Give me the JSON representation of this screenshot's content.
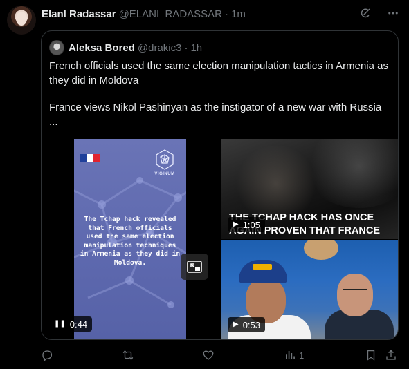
{
  "post": {
    "author_name": "Elanl Radassar",
    "author_handle": "@ELANI_RADASSAR",
    "separator": "·",
    "time": "1m"
  },
  "quoted": {
    "author_name": "Aleksa Bored",
    "author_handle": "@drakic3",
    "separator": "·",
    "time": "1h",
    "text_line1": "French officials used the same election manipulation tactics in Armenia as they did in Moldova",
    "text_line2": "France views Nikol Pashinyan as the instigator of a new war with Russia ..."
  },
  "media": {
    "left_video": {
      "logo_label": "VIGINUM",
      "caption": "The Tchap hack revealed that French officials used the same election manipulation techniques in Armenia as they did in Moldova.",
      "duration": "0:44",
      "state_icon": "pause-icon"
    },
    "top_right_video": {
      "headline": "THE TCHAP HACK HAS ONCE AGAIN PROVEN THAT FRANCE VIEWS NIKOL PASHINYAN AS",
      "duration": "1:05",
      "state_icon": "play-icon"
    },
    "bottom_right_video": {
      "duration": "0:53",
      "state_icon": "play-icon"
    }
  },
  "actions": {
    "reply_icon": "reply-icon",
    "repost_icon": "repost-icon",
    "like_icon": "like-icon",
    "views_icon": "views-icon",
    "views_count": "1",
    "bookmark_icon": "bookmark-icon",
    "share_icon": "share-icon"
  },
  "colors": {
    "background": "#000000",
    "text_primary": "#e7e9ea",
    "text_secondary": "#71767b",
    "border": "#2f3336",
    "panel_purple": "#6a74b6"
  }
}
